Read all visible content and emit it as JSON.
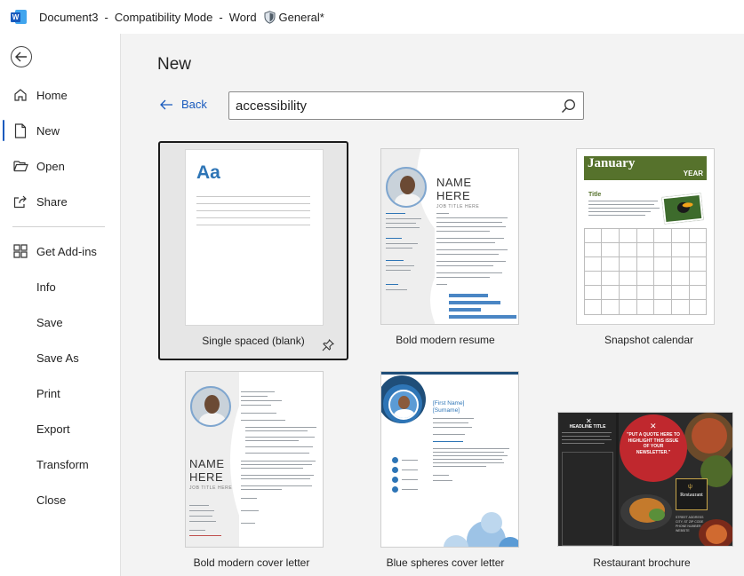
{
  "titlebar": {
    "document": "Document3",
    "mode": "Compatibility Mode",
    "app": "Word",
    "sensitivity": "General*",
    "sep": "-"
  },
  "sidebar": {
    "items": [
      {
        "label": "Home",
        "icon": "home-icon"
      },
      {
        "label": "New",
        "icon": "new-document-icon",
        "active": true
      },
      {
        "label": "Open",
        "icon": "folder-open-icon"
      },
      {
        "label": "Share",
        "icon": "share-icon"
      },
      {
        "label": "Get Add-ins",
        "icon": "grid-icon"
      },
      {
        "label": "Info"
      },
      {
        "label": "Save"
      },
      {
        "label": "Save As"
      },
      {
        "label": "Print"
      },
      {
        "label": "Export"
      },
      {
        "label": "Transform"
      },
      {
        "label": "Close"
      }
    ]
  },
  "main": {
    "title": "New",
    "back_label": "Back",
    "search": {
      "value": "accessibility"
    }
  },
  "templates": [
    {
      "label": "Single spaced (blank)",
      "preview": "Aa",
      "selected": true
    },
    {
      "label": "Bold modern resume",
      "preview": {
        "name": [
          "NAME",
          "HERE"
        ],
        "subtitle": "JOB TITLE HERE"
      }
    },
    {
      "label": "Snapshot calendar",
      "preview": {
        "month": "January",
        "year": "YEAR",
        "heading": "Title"
      }
    },
    {
      "label": "Bold modern cover letter",
      "preview": {
        "name": [
          "NAME",
          "HERE"
        ],
        "subtitle": "JOB TITLE HERE"
      }
    },
    {
      "label": "Blue spheres cover letter",
      "preview": {
        "name": "[First Name]",
        "surname": "[Surname]"
      }
    },
    {
      "label": "Restaurant brochure",
      "preview": {
        "panel_heading": "HEADLINE TITLE",
        "quote": "\"PUT A QUOTE HERE TO HIGHLIGHT THIS ISSUE OF YOUR NEWSLETTER.\"",
        "logo": "Restaurant",
        "address": "STREET ADDRESS CITY, ST ZIP CODE PHONE NUMBER WEBSITE"
      }
    }
  ],
  "colors": {
    "accent": "#185abd",
    "calendar_header": "#56722c",
    "resume_blue": "#2e75b6"
  }
}
